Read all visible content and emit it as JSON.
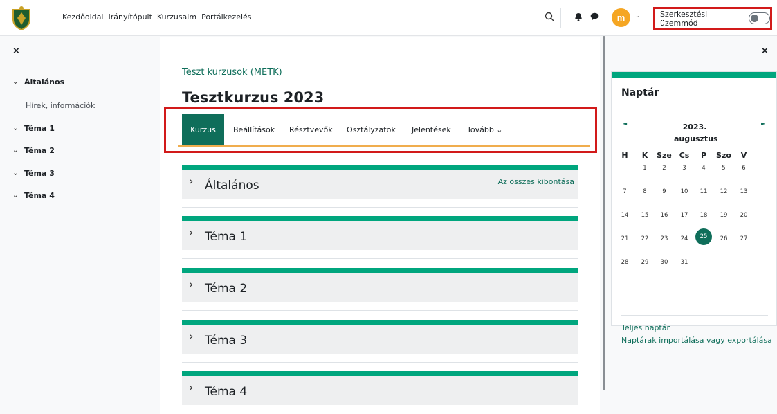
{
  "topnav": {
    "links": [
      "Kezdőoldal",
      "Irányítópult",
      "Kurzusaim",
      "Portálkezelés"
    ],
    "edit_mode_label": "Szerkesztési üzemmód",
    "avatar_initials": "m",
    "icons": [
      "search-icon",
      "bell-icon",
      "chat-icon"
    ]
  },
  "drawer_left": {
    "close": "×",
    "items": [
      {
        "label": "Általános",
        "bold": true
      },
      {
        "label": "Hírek, információk",
        "sub": true
      },
      {
        "label": "Téma 1",
        "bold": true
      },
      {
        "label": "Téma 2",
        "bold": true
      },
      {
        "label": "Téma 3",
        "bold": true
      },
      {
        "label": "Téma 4",
        "bold": true
      }
    ]
  },
  "main": {
    "breadcrumb": "Teszt kurzusok (METK)",
    "title": "Tesztkurzus 2023",
    "tabs": [
      "Kurzus",
      "Beállítások",
      "Résztvevők",
      "Osztályzatok",
      "Jelentések",
      "Tovább"
    ],
    "expand_all": "Az összes kibontása",
    "sections": [
      "Általános",
      "Téma 1",
      "Téma 2",
      "Téma 3",
      "Téma 4"
    ]
  },
  "drawer_right": {
    "close": "×",
    "calendar": {
      "title": "Naptár",
      "prev": "◄",
      "next": "►",
      "year": "2023.",
      "month": "augusztus",
      "weekdays": [
        "H",
        "K",
        "Sze",
        "Cs",
        "P",
        "Szo",
        "V"
      ],
      "weeks": [
        [
          "",
          "1",
          "2",
          "3",
          "4",
          "5",
          "6"
        ],
        [
          "7",
          "8",
          "9",
          "10",
          "11",
          "12",
          "13"
        ],
        [
          "14",
          "15",
          "16",
          "17",
          "18",
          "19",
          "20"
        ],
        [
          "21",
          "22",
          "23",
          "24",
          "25",
          "26",
          "27"
        ],
        [
          "28",
          "29",
          "30",
          "31",
          "",
          "",
          ""
        ]
      ],
      "today": "25",
      "full_calendar_link": "Teljes naptár",
      "import_export_link": "Naptárak importálása vagy exportálása"
    }
  },
  "colors": {
    "brand": "#0f6e5a",
    "accent_bar": "#00a67e",
    "highlight_box": "#d21a1a"
  }
}
